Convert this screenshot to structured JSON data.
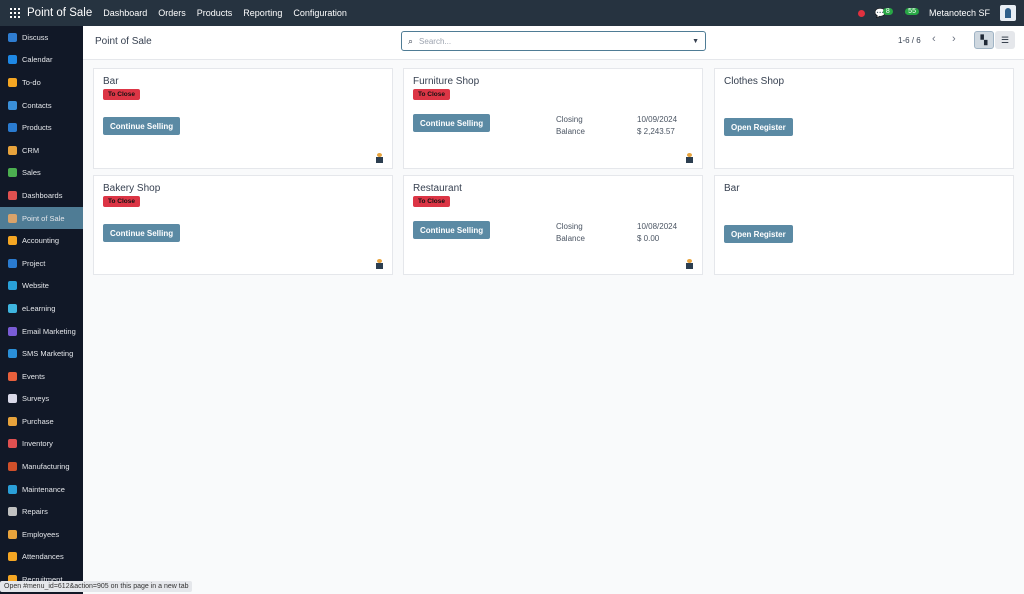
{
  "topbar": {
    "app_title": "Point of Sale",
    "menus": [
      "Dashboard",
      "Orders",
      "Products",
      "Reporting",
      "Configuration"
    ],
    "messages_count": "8",
    "activities_count": "55",
    "company": "Metanotech SF"
  },
  "sidebar": {
    "items": [
      {
        "label": "Discuss",
        "color": "#2f7dd1"
      },
      {
        "label": "Calendar",
        "color": "#1e88e5"
      },
      {
        "label": "To-do",
        "color": "#f5a623"
      },
      {
        "label": "Contacts",
        "color": "#3a8fd8"
      },
      {
        "label": "Products",
        "color": "#2a7bd0"
      },
      {
        "label": "CRM",
        "color": "#e8a33c"
      },
      {
        "label": "Sales",
        "color": "#4caf50"
      },
      {
        "label": "Dashboards",
        "color": "#e05050"
      },
      {
        "label": "Point of Sale",
        "color": "#d9a36a"
      },
      {
        "label": "Accounting",
        "color": "#f5a623"
      },
      {
        "label": "Project",
        "color": "#2a7bd0"
      },
      {
        "label": "Website",
        "color": "#29a0d8"
      },
      {
        "label": "eLearning",
        "color": "#3fb5e0"
      },
      {
        "label": "Email Marketing",
        "color": "#7a5cd6"
      },
      {
        "label": "SMS Marketing",
        "color": "#2a8fd8"
      },
      {
        "label": "Events",
        "color": "#e8603c"
      },
      {
        "label": "Surveys",
        "color": "#d9d9e8"
      },
      {
        "label": "Purchase",
        "color": "#e8a33c"
      },
      {
        "label": "Inventory",
        "color": "#e05050"
      },
      {
        "label": "Manufacturing",
        "color": "#d0502a"
      },
      {
        "label": "Maintenance",
        "color": "#2a9fd8"
      },
      {
        "label": "Repairs",
        "color": "#c0c0c0"
      },
      {
        "label": "Employees",
        "color": "#e8a33c"
      },
      {
        "label": "Attendances",
        "color": "#f5a623"
      },
      {
        "label": "Recruitment",
        "color": "#f5a623"
      }
    ],
    "active_index": 8
  },
  "header": {
    "title": "Point of Sale",
    "search_placeholder": "Search...",
    "pager": "1-6 / 6"
  },
  "cards": [
    {
      "name": "Bar",
      "tag": "To Close",
      "button": "Continue Selling"
    },
    {
      "name": "Furniture Shop",
      "tag": "To Close",
      "button": "Continue Selling",
      "closing_label": "Closing",
      "closing": "10/09/2024",
      "balance_label": "Balance",
      "balance": "$ 2,243.57"
    },
    {
      "name": "Clothes Shop",
      "button": "Open Register"
    },
    {
      "name": "Bakery Shop",
      "tag": "To Close",
      "button": "Continue Selling"
    },
    {
      "name": "Restaurant",
      "tag": "To Close",
      "button": "Continue Selling",
      "closing_label": "Closing",
      "closing": "10/08/2024",
      "balance_label": "Balance",
      "balance": "$ 0.00"
    },
    {
      "name": "Bar",
      "button": "Open Register"
    }
  ],
  "statusbar": "Open #menu_id=612&action=905 on this page in a new tab"
}
